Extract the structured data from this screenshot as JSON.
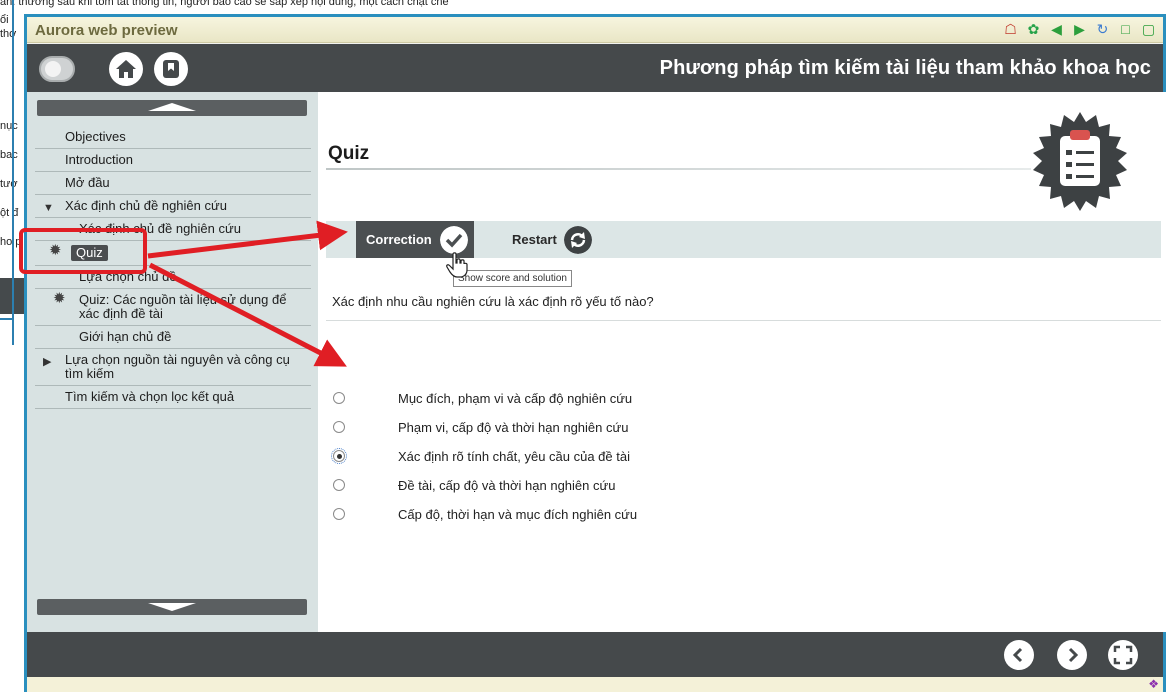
{
  "background_doc": {
    "top_line": "ản: thường sau khi tóm tắt thông tin, người báo cáo sẽ sắp xếp nội dung, một cách chặt chẽ",
    "fragments": [
      "ổi",
      "thơ",
      "nục",
      "bac",
      "tươ",
      "ột đ",
      "ho p"
    ]
  },
  "window": {
    "title": "Aurora web preview",
    "title_icons": [
      "home-icon",
      "settings-icon",
      "back-icon",
      "forward-icon",
      "refresh-icon",
      "minimize-icon",
      "maximize-icon"
    ]
  },
  "header": {
    "title": "Phương pháp tìm kiếm tài liệu tham khảo khoa học"
  },
  "sidebar": {
    "items": [
      {
        "label": "Objectives",
        "level": 0
      },
      {
        "label": "Introduction",
        "level": 0
      },
      {
        "label": "Mở đầu",
        "level": 0
      },
      {
        "label": "Xác định chủ đề nghiên cứu",
        "level": 0,
        "expanded": true
      },
      {
        "label": "Xác định chủ đề nghiên cứu",
        "level": 1
      },
      {
        "label": "Quiz",
        "level": 1,
        "active": true,
        "icon": "gear-icon"
      },
      {
        "label": "Lựa chọn chủ đề",
        "level": 1
      },
      {
        "label": "Quiz: Các nguồn tài liệu sử dụng để xác định đề tài",
        "level": 1,
        "icon": "gear-icon"
      },
      {
        "label": "Giới hạn chủ đề",
        "level": 1
      },
      {
        "label": "Lựa chọn nguồn tài nguyên và công cụ tìm kiếm",
        "level": 0,
        "collapsed": true
      },
      {
        "label": "Tìm kiếm và chọn lọc kết quả",
        "level": 0
      }
    ]
  },
  "content": {
    "title": "Quiz",
    "correction_label": "Correction",
    "restart_label": "Restart",
    "tooltip": "Show score and solution",
    "question": "Xác định nhu cầu nghiên cứu là xác định rõ yếu tố nào?",
    "options": [
      {
        "label": "Mục đích, phạm vi và cấp độ nghiên cứu",
        "selected": false
      },
      {
        "label": "Phạm vi, cấp độ và thời hạn nghiên cứu",
        "selected": false
      },
      {
        "label": "Xác định rõ tính chất, yêu cầu của đề tài",
        "selected": true
      },
      {
        "label": "Đề tài, cấp độ và thời hạn nghiên cứu",
        "selected": false
      },
      {
        "label": "Cấp độ, thời hạn và mục đích nghiên cứu",
        "selected": false
      }
    ]
  },
  "colors": {
    "header_dark": "#45494b",
    "sidebar_bg": "#d8e2e2",
    "window_border": "#2a8fbe",
    "annotation_red": "#e01e24",
    "title_bar": "#f7f5df"
  }
}
